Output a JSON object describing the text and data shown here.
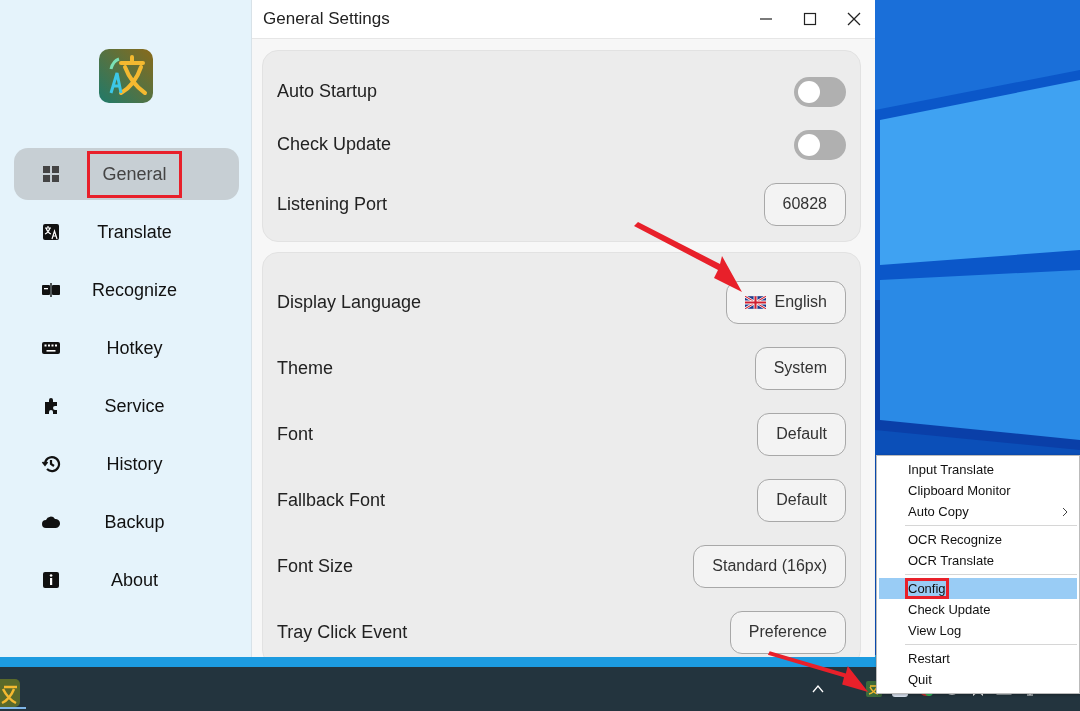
{
  "sidebar": {
    "items": [
      {
        "label": "General",
        "selected": true,
        "annotated": true
      },
      {
        "label": "Translate",
        "selected": false,
        "annotated": false
      },
      {
        "label": "Recognize",
        "selected": false,
        "annotated": false
      },
      {
        "label": "Hotkey",
        "selected": false,
        "annotated": false
      },
      {
        "label": "Service",
        "selected": false,
        "annotated": false
      },
      {
        "label": "History",
        "selected": false,
        "annotated": false
      },
      {
        "label": "Backup",
        "selected": false,
        "annotated": false
      },
      {
        "label": "About",
        "selected": false,
        "annotated": false
      }
    ]
  },
  "window": {
    "title": "General Settings"
  },
  "groups": [
    {
      "rows": [
        {
          "kind": "toggle",
          "label": "Auto Startup",
          "on": false
        },
        {
          "kind": "toggle",
          "label": "Check Update",
          "on": false
        },
        {
          "kind": "input",
          "label": "Listening Port",
          "value": "60828"
        }
      ]
    },
    {
      "rows": [
        {
          "kind": "language",
          "label": "Display Language",
          "value": "English"
        },
        {
          "kind": "select",
          "label": "Theme",
          "value": "System"
        },
        {
          "kind": "select",
          "label": "Font",
          "value": "Default"
        },
        {
          "kind": "select",
          "label": "Fallback Font",
          "value": "Default"
        },
        {
          "kind": "select",
          "label": "Font Size",
          "value": "Standard (16px)"
        },
        {
          "kind": "select",
          "label": "Tray Click Event",
          "value": "Preference"
        }
      ]
    }
  ],
  "tray_menu": {
    "sections": [
      [
        {
          "label": "Input Translate",
          "selected": false,
          "annotated": false,
          "submenu": false
        },
        {
          "label": "Clipboard Monitor",
          "selected": false,
          "annotated": false,
          "submenu": false
        },
        {
          "label": "Auto Copy",
          "selected": false,
          "annotated": false,
          "submenu": true
        }
      ],
      [
        {
          "label": "OCR Recognize",
          "selected": false,
          "annotated": false,
          "submenu": false
        },
        {
          "label": "OCR Translate",
          "selected": false,
          "annotated": false,
          "submenu": false
        }
      ],
      [
        {
          "label": "Config",
          "selected": true,
          "annotated": true,
          "submenu": false
        },
        {
          "label": "Check Update",
          "selected": false,
          "annotated": false,
          "submenu": false
        },
        {
          "label": "View Log",
          "selected": false,
          "annotated": false,
          "submenu": false
        }
      ],
      [
        {
          "label": "Restart",
          "selected": false,
          "annotated": false,
          "submenu": false
        },
        {
          "label": "Quit",
          "selected": false,
          "annotated": false,
          "submenu": false
        }
      ]
    ]
  }
}
